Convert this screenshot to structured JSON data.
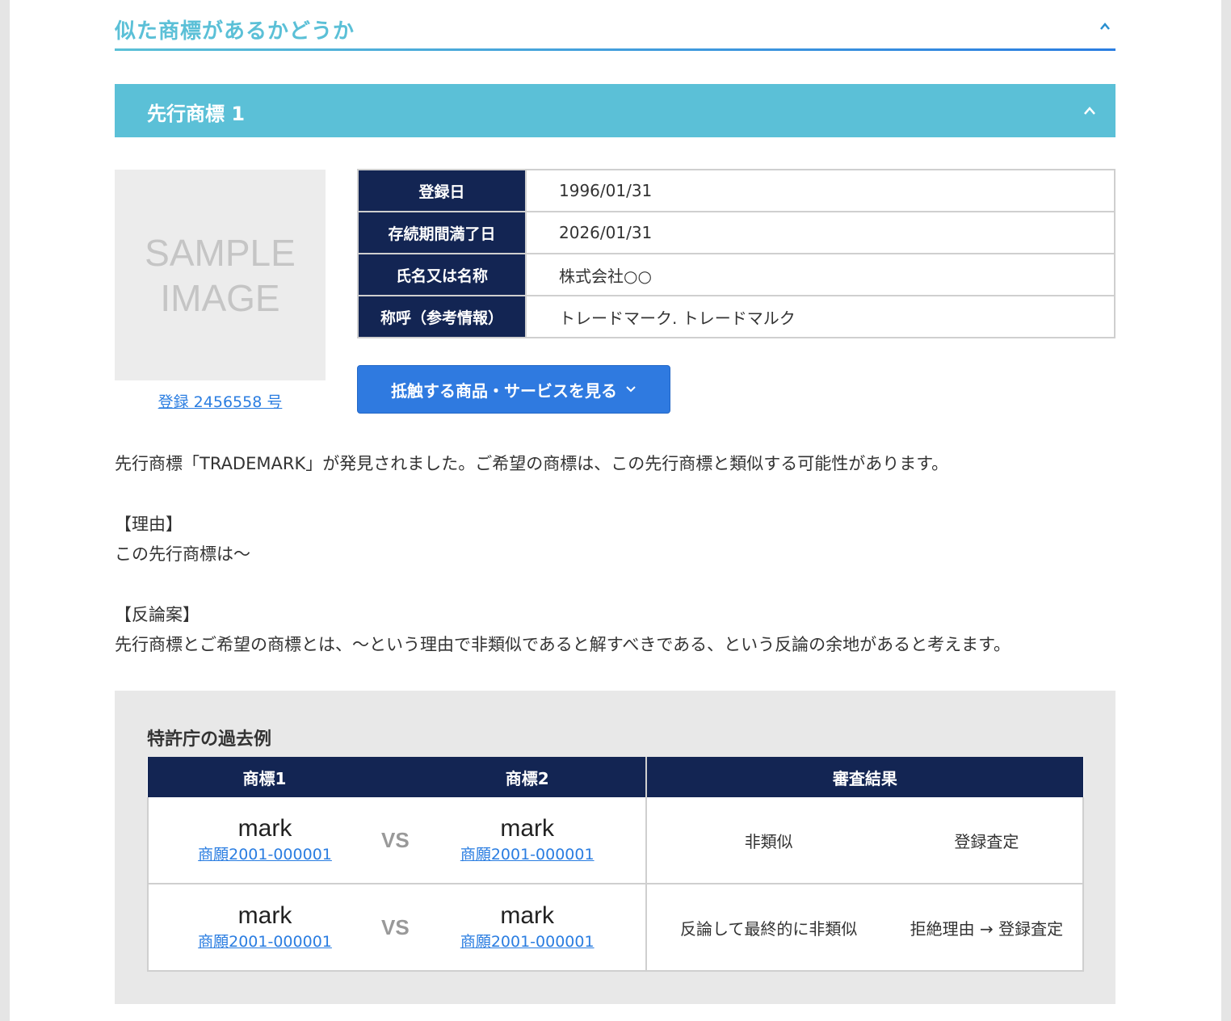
{
  "section": {
    "title": "似た商標があるかどうか"
  },
  "prior": {
    "title": "先行商標 1",
    "image_text_line1": "SAMPLE",
    "image_text_line2": "IMAGE",
    "registration_link": "登録 2456558 号",
    "fields": [
      {
        "label": "登録日",
        "value": "1996/01/31"
      },
      {
        "label": "存続期間満了日",
        "value": "2026/01/31"
      },
      {
        "label": "氏名又は名称",
        "value": "株式会社○○"
      },
      {
        "label": "称呼（参考情報）",
        "value": "トレードマーク. トレードマルク"
      }
    ],
    "goods_button": "抵触する商品・サービスを見る"
  },
  "body": {
    "finding": "先行商標「TRADEMARK」が発見されました。ご希望の商標は、この先行商標と類似する可能性があります。",
    "reason_heading": "【理由】",
    "reason_text": "この先行商標は〜",
    "rebuttal_heading": "【反論案】",
    "rebuttal_text": "先行商標とご希望の商標とは、〜という理由で非類似であると解すべきである、という反論の余地があると考えます。"
  },
  "past": {
    "title": "特許庁の過去例",
    "headers": {
      "mark1": "商標1",
      "mark2": "商標2",
      "result": "審査結果"
    },
    "vs": "VS",
    "rows": [
      {
        "mark1": "mark",
        "mark1_app": "商願2001-000001",
        "mark2": "mark",
        "mark2_app": "商願2001-000001",
        "judgment": "非類似",
        "outcome": "登録査定"
      },
      {
        "mark1": "mark",
        "mark1_app": "商願2001-000001",
        "mark2": "mark",
        "mark2_app": "商願2001-000001",
        "judgment": "反論して最終的に非類似",
        "outcome": "拒絶理由 → 登録査定"
      }
    ]
  },
  "colors": {
    "accent_teal": "#5bc0d7",
    "navy": "#132553",
    "button_blue": "#2f7ae0",
    "link_blue": "#2a7de1"
  },
  "icons": {
    "collapse": "chevron-up-icon",
    "expand": "chevron-down-icon"
  }
}
